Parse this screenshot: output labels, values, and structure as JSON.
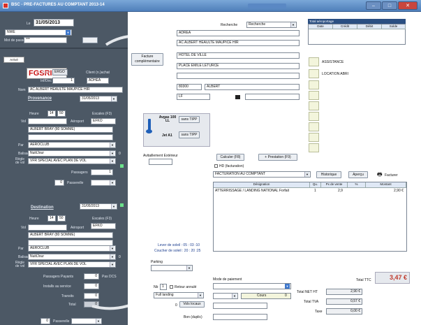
{
  "titlebar": {
    "title": "BSC - PRE-FACTURES AU COMPTANT 2013-14",
    "min": "–",
    "max": "□",
    "close": "✕"
  },
  "left": {
    "le_label": "Le",
    "date": "31/05/2013",
    "field_b": "NWE",
    "mot_passe_label": "Mot de passe",
    "mot_passe_value": "***",
    "code_badge": "Arrivé",
    "code": "FGSRI",
    "type_label": "Type",
    "type_value": "ERGO",
    "client_label": "Client (n.)achat",
    "id_label": "Inf/Doc",
    "id_value": "1",
    "client_value": "ADHEA",
    "nom_label": "Nom",
    "nom_value": "AC ALBERT HEAULTE MAUPICE HIR",
    "provenance": "Provenance",
    "prov_date": "31/05/2013",
    "heure_label": "Heure",
    "heure_h": "14",
    "heure_m": "50",
    "escales_label": "Escales (F3)",
    "vol_label": "Vol",
    "aeroport_label": "Aéroport",
    "aeroport_value": "EFKO",
    "city_prov": "ALBERT BRAY (80 SOMME)",
    "par_label": "Par",
    "par_value": "AEROCLUB",
    "balisage_label": "Balisage",
    "balisage_value": "Nuit/Jour",
    "balisage_num": "0",
    "regle_label": "Règle de vol",
    "regle_value": "VFR SPECIAL AVEC PLAN DE VOL",
    "passagers_label": "Passagers",
    "passagers_value": "1",
    "pax_num": "0",
    "pax_label": "Passerelle",
    "destination": "Destination",
    "dest_date": "31/05/2013",
    "dheure_h": "14",
    "dheure_m": "50",
    "daeroport_value": "EFKO",
    "city_dest": "ALBERT BRAY (80 SOMME)",
    "dpar_value": "AEROCLUB",
    "dbalisage_value": "Nuit/Jour",
    "dbalisage_num": "0",
    "dregle_value": "VFR SPECIAL AVEC PLAN DE VOL",
    "pp_label": "Passagers Payants",
    "pp_value": "0",
    "pas_label": "Pas DCS",
    "inst_label": "Installs au service",
    "inst_value": "0",
    "transit_label": "Transits",
    "transit_value": "0",
    "total_label": "Total",
    "total_value": "0",
    "bottom_num": "0",
    "bottom_label": "Passerelle"
  },
  "main": {
    "recherche_label": "Recherche",
    "recherche_value": "Recherche",
    "addr1": "ADREA",
    "addr2": "AC ALBERT HEAULTE MAUPICE HIR",
    "facture_btn": "Facture complémentaire",
    "addr3": "HOTEL DE VILLE",
    "addr4": "PLACE EMILE LETURCE",
    "addr5": "",
    "cp": "80300",
    "ville": "ALBERT",
    "f1": "LF",
    "totaux_title": "Total aéroportage",
    "totaux_cols": [
      "Date",
      "Crédit",
      "Débit",
      "Solde"
    ],
    "assistance": "ASSISTANCE",
    "location": "LOCATION ABRI",
    "avgas_label": "Avgas 100 LL",
    "avgas_btn": "sans TIPP",
    "jet_label": "Jet A1",
    "jet_btn": "sans TIPP",
    "avitaillement": "Avitaillement Extérieur",
    "calculer_btn": "Calculer (F8)",
    "prestation_btn": "+ Prestation (F9)",
    "hd_label": "HD (facturation)",
    "fact_select": "FACTURATION AU COMPTANT",
    "historique_btn": "Historique",
    "apercu_btn": "Aperçu",
    "facturer_btn": "Facturer",
    "table_cols": [
      "Désignation",
      "Qu.",
      "Px de vente",
      "%",
      "Montant"
    ],
    "table_rows": [
      [
        "ATTERRISSAGE / LANDING NATIONAL Forfait",
        "1",
        "2,9",
        "",
        "2,90 €"
      ]
    ],
    "soleil1": "Lever de soleil : 05 : 03 :10",
    "soleil2": "Coucher de soleil : 20 : 20 :25",
    "parking_label": "Parking",
    "nb_label": "Nb",
    "nb_value": "1",
    "retour_label": "Retour annulé",
    "full_landing": "Full landing",
    "vols_num": "0",
    "vols_btn": "Vols locaux",
    "mode_label": "Mode de paiement",
    "cours_label": "Cours",
    "cours_value": "0",
    "bon_label": "Bon (duplic)",
    "total_ttc_label": "Total TTC",
    "total_ttc_value": "3,47 €",
    "total_ht_label": "Total NET HT",
    "total_ht_value": "2,90 €",
    "tva_label": "Total TVA",
    "tva_value": "0,57 €",
    "taxe_label": "Taxe",
    "taxe_value": "0,00 €"
  },
  "colors": {
    "left_panel": "#4c5865",
    "titlebar": "#5f8fcb",
    "accent_red": "#c81010",
    "total_highlight": "#c0392b"
  }
}
